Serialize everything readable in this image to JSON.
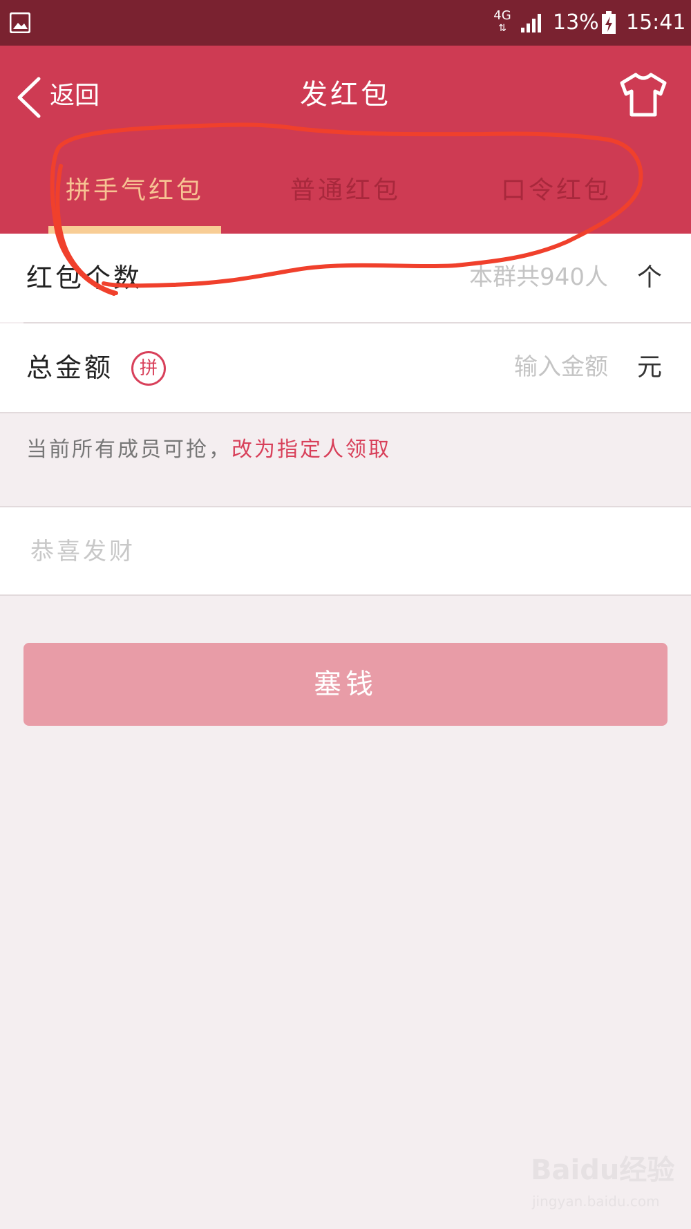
{
  "status_bar": {
    "network": "4G",
    "network_arrows": "⇅",
    "battery_percent": "13%",
    "time": "15:41"
  },
  "header": {
    "back_label": "返回",
    "title": "发红包"
  },
  "tabs": [
    {
      "label": "拼手气红包",
      "active": true
    },
    {
      "label": "普通红包",
      "active": false
    },
    {
      "label": "口令红包",
      "active": false
    }
  ],
  "form": {
    "count_label": "红包个数",
    "count_placeholder": "本群共940人",
    "count_unit": "个",
    "amount_label": "总金额",
    "amount_badge": "拼",
    "amount_placeholder": "输入金额",
    "amount_unit": "元"
  },
  "hint": {
    "text": "当前所有成员可抢，",
    "link": "改为指定人领取"
  },
  "greeting": {
    "placeholder": "恭喜发财"
  },
  "submit_label": "塞钱",
  "watermark": {
    "logo": "Baidu经验",
    "url": "jingyan.baidu.com"
  },
  "colors": {
    "status_bar": "#7a2230",
    "header": "#ce3b53",
    "active_tab": "#f7c393",
    "tab_underline": "#f8cd95",
    "submit": "#e89ca7",
    "annotation": "#f0402c"
  }
}
